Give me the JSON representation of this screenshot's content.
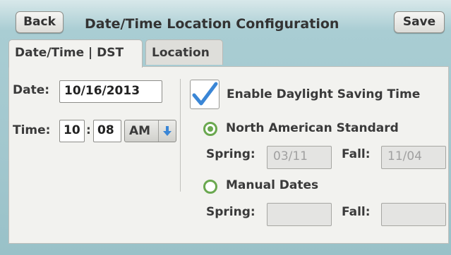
{
  "header": {
    "back_label": "Back",
    "title": "Date/Time Location Configuration",
    "save_label": "Save"
  },
  "tabs": [
    {
      "label": "Date/Time | DST",
      "active": true
    },
    {
      "label": "Location",
      "active": false
    }
  ],
  "datetime": {
    "date_label": "Date:",
    "date_value": "10/16/2013",
    "time_label": "Time:",
    "hour": "10",
    "separator": ":",
    "minute": "08",
    "ampm": "AM",
    "ampm_icon": "arrow-down-icon"
  },
  "dst": {
    "enable_label": "Enable Daylight Saving Time",
    "enabled": true,
    "options": [
      {
        "label": "North American Standard",
        "selected": true
      },
      {
        "label": "Manual Dates",
        "selected": false
      }
    ],
    "na_spring_label": "Spring:",
    "na_spring_value": "03/11",
    "na_fall_label": "Fall:",
    "na_fall_value": "11/04",
    "manual_spring_label": "Spring:",
    "manual_spring_value": "",
    "manual_fall_label": "Fall:",
    "manual_fall_value": ""
  },
  "colors": {
    "accent_green": "#6aa84f",
    "check_blue": "#3a86d6"
  }
}
